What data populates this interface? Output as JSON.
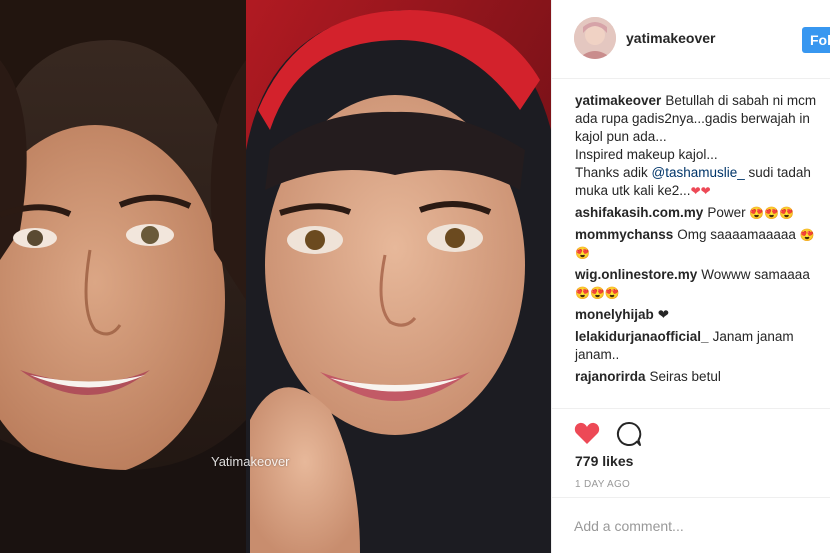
{
  "post": {
    "watermark": "Yatimakeover"
  },
  "header": {
    "username": "yatimakeover",
    "follow_label": "Fol"
  },
  "caption": {
    "user": "yatimakeover",
    "line1": "Betullah di sabah ni mcm",
    "line2": "ada rupa gadis2nya...gadis berwajah in",
    "line3": "kajol pun ada...",
    "line4": "Inspired makeup kajol...",
    "line5_pre": "Thanks adik ",
    "mention": "@tashamuslie_",
    "line5_post": " sudi tadah",
    "line6": "muka utk kali ke2...",
    "line6_emoji": "❤❤"
  },
  "comments": [
    {
      "user": "ashifakasih.com.my",
      "text": "Power",
      "emoji": "😍😍😍"
    },
    {
      "user": "mommychanss",
      "text": "Omg saaaamaaaaa",
      "emoji": "😍",
      "emoji2": "😍"
    },
    {
      "user": "wig.onlinestore.my",
      "text": "Wowww samaaaa",
      "emoji": "😍😍😍"
    },
    {
      "user": "monelyhijab",
      "text": "❤"
    },
    {
      "user": "lelakidurjanaofficial_",
      "text": "Janam janam",
      "text2": "janam.."
    },
    {
      "user": "rajanorirda",
      "text": "Seiras betul"
    }
  ],
  "actions": {
    "likes": "779 likes",
    "date": "1 DAY AGO",
    "like_color": "#ed4956"
  },
  "add_comment": {
    "placeholder": "Add a comment..."
  },
  "colors": {
    "accent": "#3897f0",
    "text": "#262626",
    "muted": "#999999"
  }
}
